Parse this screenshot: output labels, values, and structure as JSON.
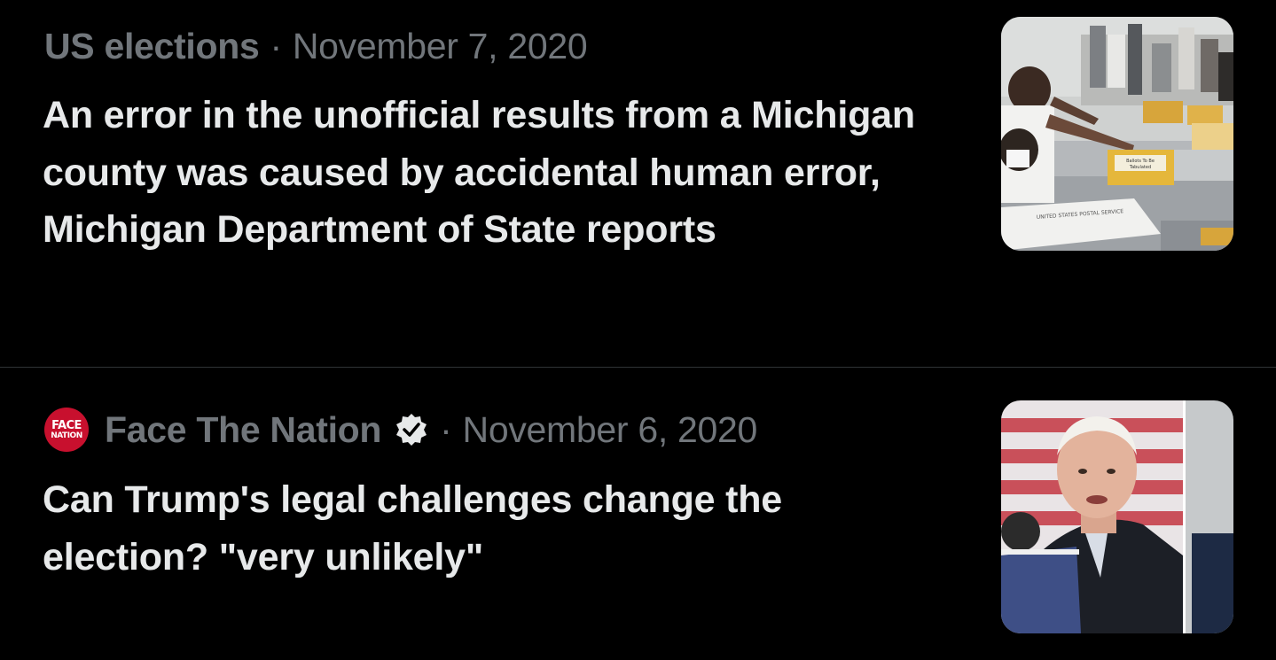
{
  "items": [
    {
      "topic": "US elections",
      "separator": "·",
      "date": "November 7, 2020",
      "headline": "An error in the unofficial results from a Michigan county was caused by accidental human error, Michigan Department of State reports",
      "thumbnail": {
        "box_label": "Ballots To Be Tabulated",
        "tray_label": "UNITED STATES POSTAL SERVICE"
      }
    },
    {
      "source_logo": {
        "line1": "FACE",
        "line2": "NATION",
        "color": "#c8102e"
      },
      "source": "Face The Nation",
      "verified_icon": "verified-badge-icon",
      "separator": "·",
      "date": "November 6, 2020",
      "headline": "Can Trump's legal challenges change the election? \"very unlikely\""
    }
  ],
  "colors": {
    "background": "#000000",
    "meta_text": "#71767b",
    "headline_text": "#e7e9ea",
    "divider": "#2f3336"
  }
}
